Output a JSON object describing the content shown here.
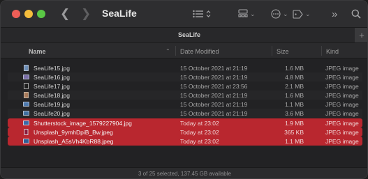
{
  "window": {
    "title": "SeaLife"
  },
  "toolbar": {
    "icons": [
      "back-icon",
      "forward-icon",
      "list-view-icon",
      "group-icon",
      "action-icon",
      "tag-icon",
      "overflow-icon",
      "search-icon"
    ]
  },
  "pathbar": {
    "title": "SeaLife"
  },
  "columns": {
    "name": "Name",
    "date": "Date Modified",
    "size": "Size",
    "kind": "Kind"
  },
  "files": [
    {
      "name": "SeaLife15.jpg",
      "date": "15 October 2021 at 21:19",
      "size": "1.6 MB",
      "kind": "JPEG image",
      "selected": false
    },
    {
      "name": "SeaLife16.jpg",
      "date": "15 October 2021 at 21:19",
      "size": "4.8 MB",
      "kind": "JPEG image",
      "selected": false
    },
    {
      "name": "SeaLife17.jpg",
      "date": "15 October 2021 at 23:56",
      "size": "2.1 MB",
      "kind": "JPEG image",
      "selected": false
    },
    {
      "name": "SeaLife18.jpg",
      "date": "15 October 2021 at 21:19",
      "size": "1.6 MB",
      "kind": "JPEG image",
      "selected": false
    },
    {
      "name": "SeaLife19.jpg",
      "date": "15 October 2021 at 21:19",
      "size": "1.1 MB",
      "kind": "JPEG image",
      "selected": false
    },
    {
      "name": "SeaLife20.jpg",
      "date": "15 October 2021 at 21:19",
      "size": "3.6 MB",
      "kind": "JPEG image",
      "selected": false
    },
    {
      "name": "Shutterstock_image_1579227904.jpg",
      "date": "Today at 23:02",
      "size": "1.9 MB",
      "kind": "JPEG image",
      "selected": true
    },
    {
      "name": "Unsplash_9ymhDpiB_Bw.jpeg",
      "date": "Today at 23:02",
      "size": "365 KB",
      "kind": "JPEG image",
      "selected": true
    },
    {
      "name": "Unsplash_A5sVh4KbR88.jpeg",
      "date": "Today at 23:02",
      "size": "1.1 MB",
      "kind": "JPEG image",
      "selected": true
    }
  ],
  "status": {
    "text": "3 of 25 selected, 137.45 GB available"
  },
  "colors": {
    "selection": "#b9272f",
    "background": "#222224",
    "close": "#ee5e57",
    "minimize": "#f4bd3c",
    "maximize": "#5ac845"
  }
}
